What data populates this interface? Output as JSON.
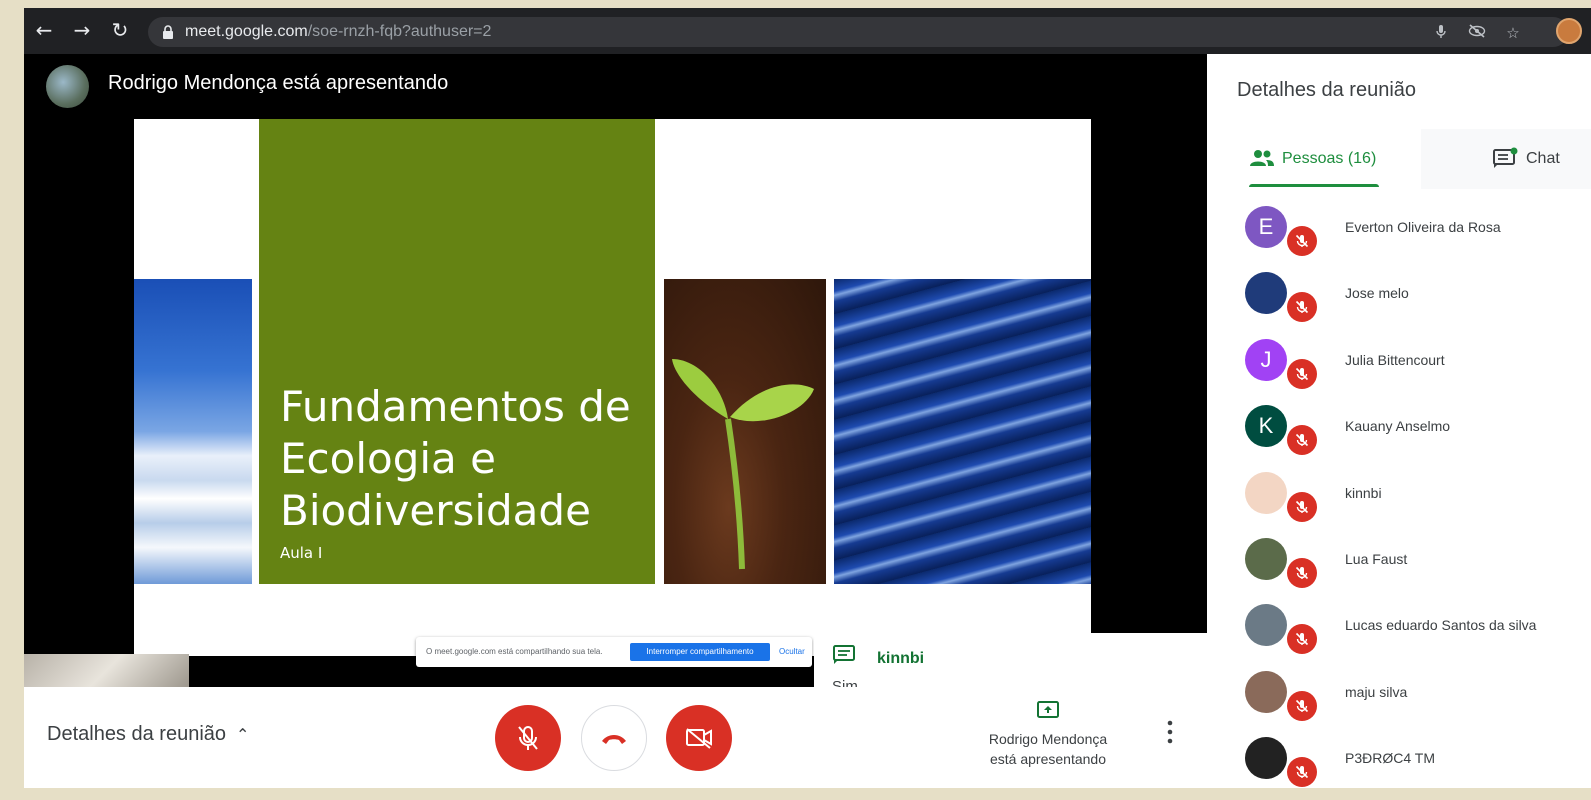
{
  "browser": {
    "url_host": "meet.google.com",
    "url_path": "/soe-rnzh-fqb?authuser=2"
  },
  "meeting": {
    "presenter_banner": "Rodrigo Mendonça está apresentando"
  },
  "slide": {
    "title": "Fundamentos de\nEcologia e\nBiodiversidade",
    "subtitle": "Aula I"
  },
  "share_bar": {
    "text": "O meet.google.com está compartilhando sua tela.",
    "stop_label": "Interromper compartilhamento",
    "hide_label": "Ocultar"
  },
  "chat_popup": {
    "sender": "kinnbi",
    "message": "Sim"
  },
  "bottom_bar": {
    "details_label": "Detalhes da reunião",
    "presenting_label": "Rodrigo Mendonça\nestá apresentando"
  },
  "side_panel": {
    "title": "Detalhes da reunião",
    "tabs": [
      {
        "label": "Pessoas (16)"
      },
      {
        "label": "Chat"
      }
    ],
    "people": [
      {
        "name": "Everton Oliveira da Rosa",
        "initial": "E",
        "color": "#7e57c2"
      },
      {
        "name": "Jose melo",
        "initial": "",
        "color": "#1f3b7a"
      },
      {
        "name": "Julia Bittencourt",
        "initial": "J",
        "color": "#a142f4"
      },
      {
        "name": "Kauany Anselmo",
        "initial": "K",
        "color": "#004d40"
      },
      {
        "name": "kinnbi",
        "initial": "",
        "color": "#f3d6c4"
      },
      {
        "name": "Lua Faust",
        "initial": "",
        "color": "#5b6b4a"
      },
      {
        "name": "Lucas eduardo Santos da silva",
        "initial": "",
        "color": "#6b7a86"
      },
      {
        "name": "maju silva",
        "initial": "",
        "color": "#8a6a5a"
      },
      {
        "name": "P3ÐRØC4 TM",
        "initial": "",
        "color": "#222222"
      }
    ]
  },
  "colors": {
    "accent_green": "#1e8e3e",
    "alert_red": "#d93025",
    "slide_green": "#658313"
  }
}
